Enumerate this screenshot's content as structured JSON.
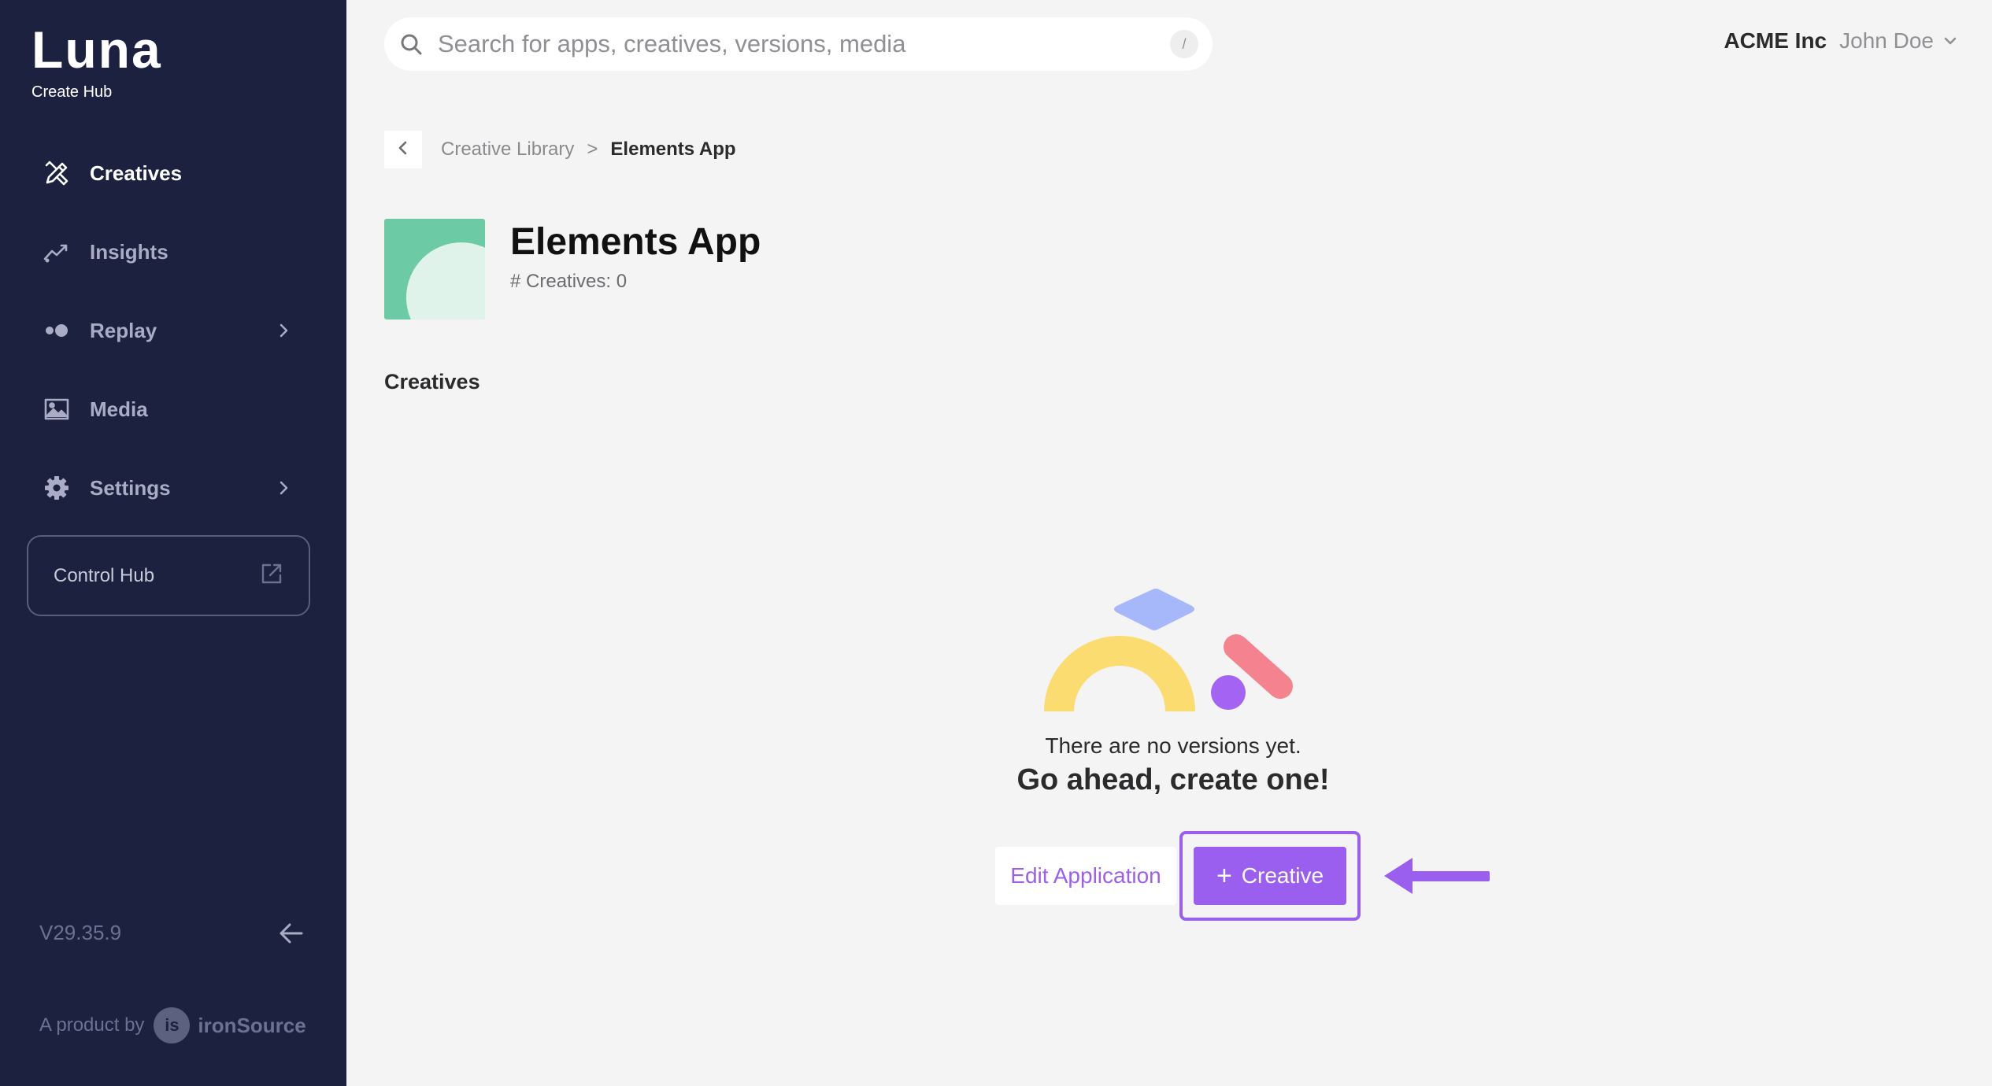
{
  "brand": {
    "name": "Luna",
    "subtitle": "Create Hub"
  },
  "sidebar": {
    "items": [
      {
        "label": "Creatives",
        "icon": "creatives-pencil-icon",
        "active": true
      },
      {
        "label": "Insights",
        "icon": "insights-chart-icon",
        "active": false
      },
      {
        "label": "Replay",
        "icon": "replay-dots-icon",
        "active": false,
        "has_submenu": true
      },
      {
        "label": "Media",
        "icon": "media-image-icon",
        "active": false
      },
      {
        "label": "Settings",
        "icon": "settings-gear-icon",
        "active": false,
        "has_submenu": true
      }
    ],
    "control_hub": {
      "label": "Control Hub",
      "icon": "external-link-icon"
    },
    "version": "V29.35.9",
    "product_by": {
      "text": "A product by",
      "badge": "is",
      "company": "ironSource"
    }
  },
  "search": {
    "placeholder": "Search for apps, creatives, versions, media",
    "value": "",
    "shortcut": "/"
  },
  "account": {
    "org": "ACME Inc",
    "user": "John Doe"
  },
  "breadcrumb": {
    "parent": "Creative Library",
    "separator": ">",
    "current": "Elements App"
  },
  "app": {
    "title": "Elements App",
    "creatives_count": "# Creatives: 0",
    "thumb_color": "#6ccba4"
  },
  "section": {
    "title": "Creatives"
  },
  "empty_state": {
    "line1": "There are no versions yet.",
    "line2": "Go ahead, create one!",
    "illustration_colors": {
      "arch": "#fbdc70",
      "diamond": "#a7b8fa",
      "pill": "#f4838f",
      "dot": "#a463f2"
    }
  },
  "actions": {
    "edit_label": "Edit Application",
    "create_label": "Creative",
    "create_icon": "plus"
  },
  "colors": {
    "sidebar_bg": "#1d2140",
    "accent": "#9b5ff0",
    "page_bg": "#f3f4f3"
  }
}
